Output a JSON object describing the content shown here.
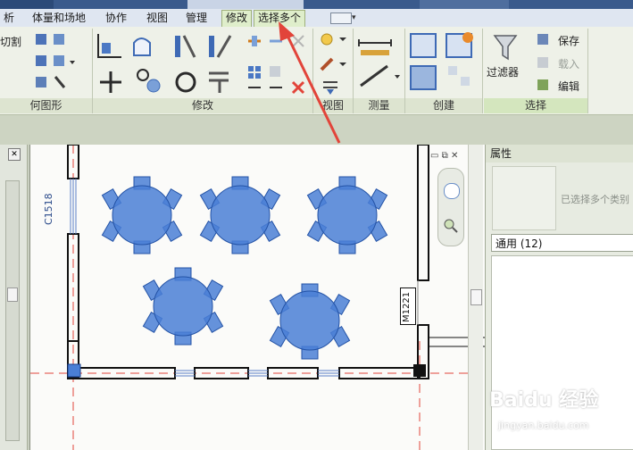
{
  "title_bar": {
    "doc_fragment": "",
    "search_fragment": ""
  },
  "tabs": [
    {
      "label": "析"
    },
    {
      "label": "体量和场地"
    },
    {
      "label": "协作"
    },
    {
      "label": "视图"
    },
    {
      "label": "管理"
    },
    {
      "label": "修改"
    },
    {
      "label": "选择多个"
    }
  ],
  "ribbon": {
    "left_panel_partial_label": "何图形",
    "left_top_text": "切割",
    "panels": [
      {
        "label": "修改"
      },
      {
        "label": "视图"
      },
      {
        "label": "测量"
      },
      {
        "label": "创建"
      },
      {
        "label": "选择"
      }
    ],
    "filter_label": "过滤器",
    "save_label": "保存",
    "load_label": "载入",
    "edit_label": "编辑"
  },
  "properties": {
    "header": "属性",
    "multi_type_label": "已选择多个类别",
    "filter_value": "通用 (12)"
  },
  "canvas": {
    "window_tag_left": "C1518",
    "door_tag_right": "M1221"
  },
  "watermark": {
    "brand": "Baidu 经验",
    "url": "jingyan.baidu.com"
  },
  "colors": {
    "selection_blue": "#4a7fd6",
    "annotation_red": "#e2443a",
    "accent_green": "#dfeecb"
  }
}
